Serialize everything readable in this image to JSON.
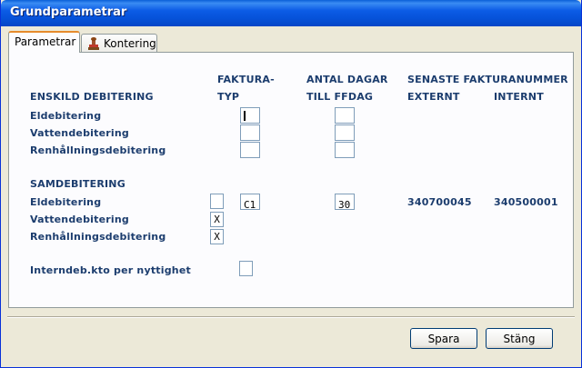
{
  "window": {
    "title": "Grundparametrar"
  },
  "tabs": [
    {
      "label": "Parametrar",
      "active": true
    },
    {
      "label": "Kontering",
      "icon": "stamp-icon"
    }
  ],
  "headers": {
    "faktura_line1": "FAKTURA-",
    "faktura_line2": "TYP",
    "antal_line1": "ANTAL DAGAR",
    "antal_line2": "TILL FFDAG",
    "senaste": "SENASTE FAKTURANUMMER",
    "externt": "EXTERNT",
    "internt": "INTERNT"
  },
  "enskild": {
    "title": "ENSKILD DEBITERING",
    "rows": [
      {
        "label": "Eldebitering",
        "fakturatyp": "",
        "antal_dagar": ""
      },
      {
        "label": "Vattendebitering",
        "fakturatyp": "",
        "antal_dagar": ""
      },
      {
        "label": "Renhållningsdebitering",
        "fakturatyp": "",
        "antal_dagar": ""
      }
    ]
  },
  "samdebitering": {
    "title": "SAMDEBITERING",
    "rows": [
      {
        "label": "Eldebitering",
        "checked": "",
        "fakturatyp": "C1",
        "antal_dagar": "30",
        "externt": "340700045",
        "internt": "340500001"
      },
      {
        "label": "Vattendebitering",
        "checked": "X"
      },
      {
        "label": "Renhållningsdebitering",
        "checked": "X"
      }
    ]
  },
  "internal": {
    "label": "Interndeb.kto per nyttighet",
    "value": ""
  },
  "buttons": {
    "save": "Spara",
    "close": "Stäng"
  },
  "colors": {
    "label_text": "#1c3d6e",
    "title_bar": "#0652d9",
    "tab_highlight": "#e68b2c"
  }
}
